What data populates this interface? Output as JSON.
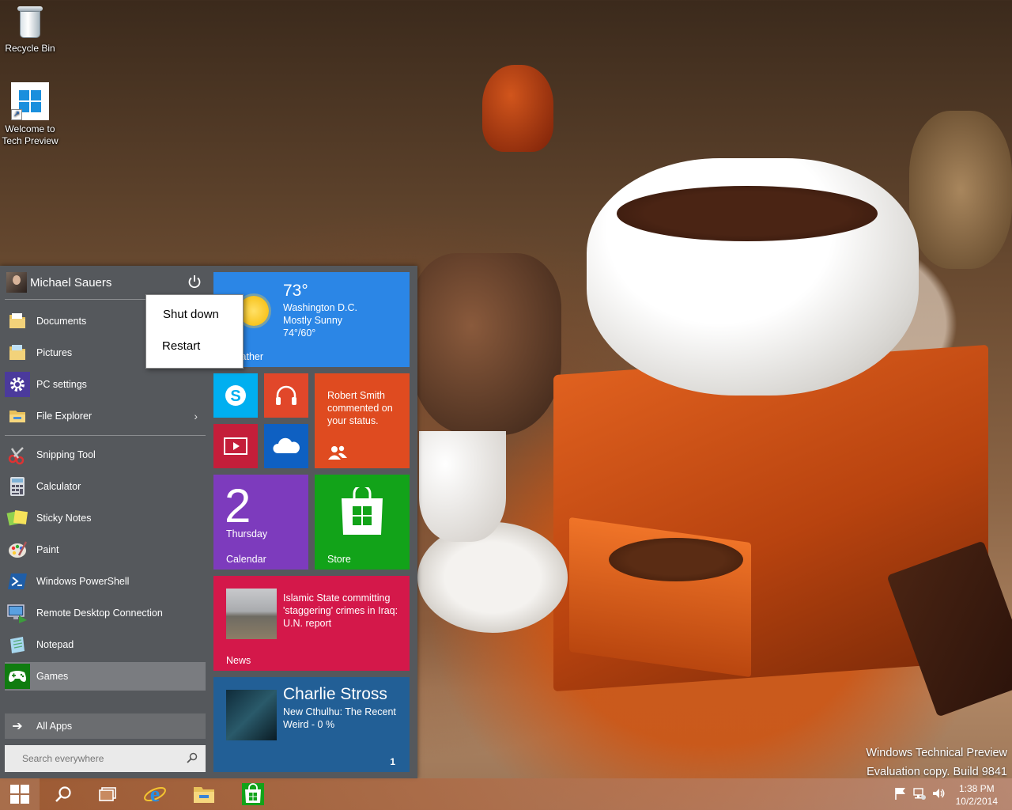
{
  "desktop": {
    "icons": [
      {
        "label": "Recycle Bin"
      },
      {
        "label": "Welcome to Tech Preview"
      }
    ]
  },
  "start_menu": {
    "user_name": "Michael Sauers",
    "places": [
      {
        "label": "Documents",
        "icon": "folder-icon"
      },
      {
        "label": "Pictures",
        "icon": "folder-icon"
      },
      {
        "label": "PC settings",
        "icon": "gear-icon"
      },
      {
        "label": "File Explorer",
        "icon": "file-explorer-icon"
      }
    ],
    "apps": [
      {
        "label": "Snipping Tool",
        "icon": "scissors-icon"
      },
      {
        "label": "Calculator",
        "icon": "calculator-icon"
      },
      {
        "label": "Sticky Notes",
        "icon": "sticky-notes-icon"
      },
      {
        "label": "Paint",
        "icon": "palette-icon"
      },
      {
        "label": "Windows PowerShell",
        "icon": "powershell-icon"
      },
      {
        "label": "Remote Desktop Connection",
        "icon": "remote-desktop-icon"
      },
      {
        "label": "Notepad",
        "icon": "notepad-icon"
      },
      {
        "label": "Games",
        "icon": "gamepad-icon"
      }
    ],
    "all_apps_label": "All Apps",
    "search_placeholder": "Search everywhere",
    "power_menu": {
      "shut_down": "Shut down",
      "restart": "Restart"
    }
  },
  "tiles": {
    "weather": {
      "temp": "73°",
      "city": "Washington D.C.",
      "condition": "Mostly Sunny",
      "range": "74°/60°",
      "label": "Weather"
    },
    "people": {
      "text": "Robert Smith commented on your status."
    },
    "calendar": {
      "day": "2",
      "weekday": "Thursday",
      "label": "Calendar"
    },
    "store": {
      "label": "Store"
    },
    "news": {
      "headline": "Islamic State committing 'staggering' crimes in Iraq: U.N. report",
      "label": "News"
    },
    "kindle": {
      "author": "Charlie Stross",
      "title": "New Cthulhu: The Recent Weird - 0 %",
      "badge": "1"
    }
  },
  "watermark": {
    "line1": "Windows Technical Preview",
    "line2": "Evaluation copy. Build 9841"
  },
  "taskbar": {
    "pinned": [
      "start-icon",
      "search-icon",
      "task-view-icon",
      "internet-explorer-icon",
      "file-explorer-icon",
      "store-icon"
    ],
    "tray": [
      "flag-icon",
      "network-icon",
      "volume-icon"
    ],
    "time": "1:38 PM",
    "date": "10/2/2014"
  },
  "colors": {
    "start_bg": "#55585c",
    "weather": "#2b86e6",
    "skype": "#00aff0",
    "music": "#e1472a",
    "video": "#c41e3a",
    "onedrive": "#0e60c2",
    "people": "#df4b20",
    "calendar": "#7d3bbd",
    "store": "#12a319",
    "news": "#d4184a",
    "kindle": "#225f96"
  }
}
